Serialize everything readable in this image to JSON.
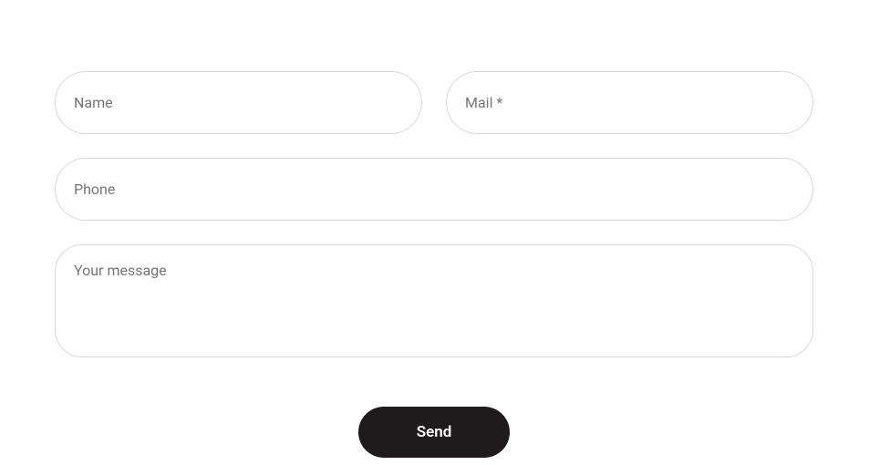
{
  "form": {
    "name": {
      "placeholder": "Name",
      "value": ""
    },
    "mail": {
      "placeholder": "Mail *",
      "value": ""
    },
    "phone": {
      "placeholder": "Phone",
      "value": ""
    },
    "message": {
      "placeholder": "Your message",
      "value": ""
    },
    "submit_label": "Send"
  }
}
